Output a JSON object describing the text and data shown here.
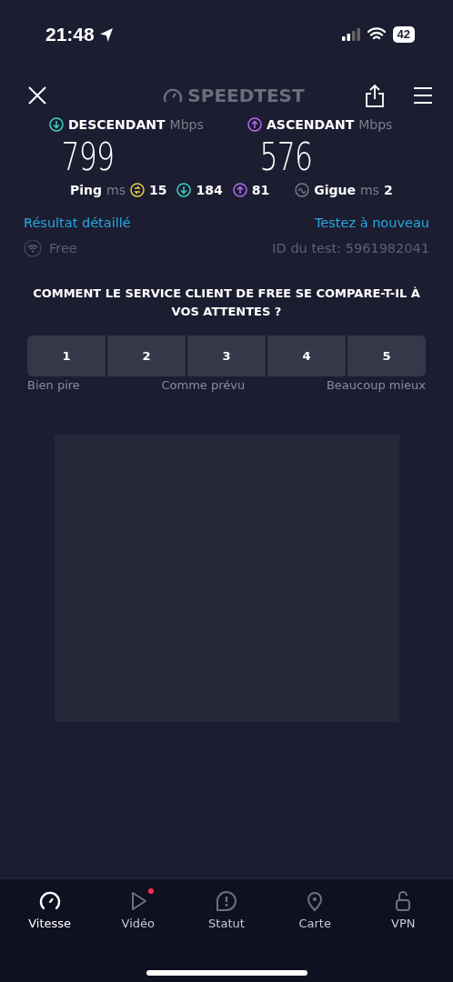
{
  "status_bar": {
    "time": "21:48",
    "battery": "42"
  },
  "header": {
    "logo": "SPEEDTEST"
  },
  "download": {
    "label": "DESCENDANT",
    "unit": "Mbps",
    "value": "799"
  },
  "upload": {
    "label": "ASCENDANT",
    "unit": "Mbps",
    "value": "576"
  },
  "ping": {
    "label": "Ping",
    "unit": "ms",
    "idle": "15",
    "down": "184",
    "up": "81"
  },
  "jitter": {
    "label": "Gigue",
    "unit": "ms",
    "value": "2"
  },
  "links": {
    "detail": "Résultat détaillé",
    "retest": "Testez à nouveau"
  },
  "provider": {
    "name": "Free",
    "test_id": "ID du test: 5961982041"
  },
  "survey": {
    "question": "COMMENT LE SERVICE CLIENT DE FREE SE COMPARE-T-IL À VOS ATTENTES ?",
    "options": [
      "1",
      "2",
      "3",
      "4",
      "5"
    ],
    "scale_labels": [
      "Bien pire",
      "Comme prévu",
      "Beaucoup mieux"
    ]
  },
  "ad": {
    "kind": "placeholder"
  },
  "tabs": [
    {
      "label": "Vitesse",
      "kind": "speed",
      "selected": true,
      "badge": false
    },
    {
      "label": "Vidéo",
      "kind": "video",
      "selected": false,
      "badge": true
    },
    {
      "label": "Statut",
      "kind": "status",
      "selected": false,
      "badge": false
    },
    {
      "label": "Carte",
      "kind": "map",
      "selected": false,
      "badge": false
    },
    {
      "label": "VPN",
      "kind": "vpn",
      "selected": false,
      "badge": false
    }
  ]
}
